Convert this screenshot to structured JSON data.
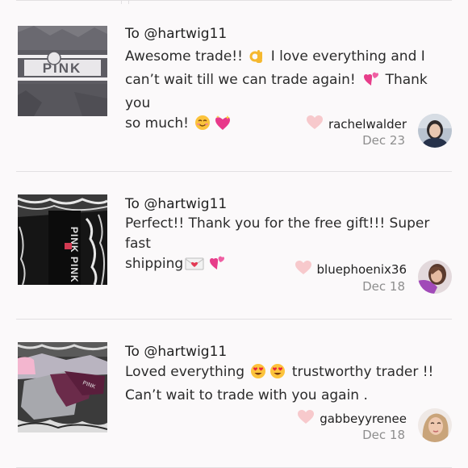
{
  "reviews": [
    {
      "to_prefix": "To ",
      "handle": "@hartwig11",
      "message_lines": [
        "Awesome trade!!",
        "I love everything and I",
        "can’t wait till we can trade again!",
        "Thank you",
        "so much!"
      ],
      "reviewer": "rachelwalder",
      "date": "Dec 23",
      "thumb_icon": "pink-sweatshirt-photo",
      "avatar_icon": "user-avatar-photo"
    },
    {
      "to_prefix": "To ",
      "handle": "@hartwig11",
      "message_lines": [
        "Perfect!! Thank you for the free gift!!! Super fast",
        "shipping"
      ],
      "reviewer": "bluephoenix36",
      "date": "Dec 18",
      "thumb_icon": "pink-leggings-photo",
      "avatar_icon": "user-avatar-photo"
    },
    {
      "to_prefix": "To ",
      "handle": "@hartwig11",
      "message_lines": [
        "Loved everything",
        "trustworthy trader !!",
        "Can’t wait to trade with you again ."
      ],
      "reviewer": "gabbeyyrenee",
      "date": "Dec 18",
      "thumb_icon": "clothes-on-bed-photo",
      "avatar_icon": "user-avatar-photo"
    }
  ],
  "colors": {
    "background": "#fbf9fa",
    "heart": "#f7c9cc",
    "date": "#8e8e8e",
    "divider": "#e2e0e2"
  }
}
